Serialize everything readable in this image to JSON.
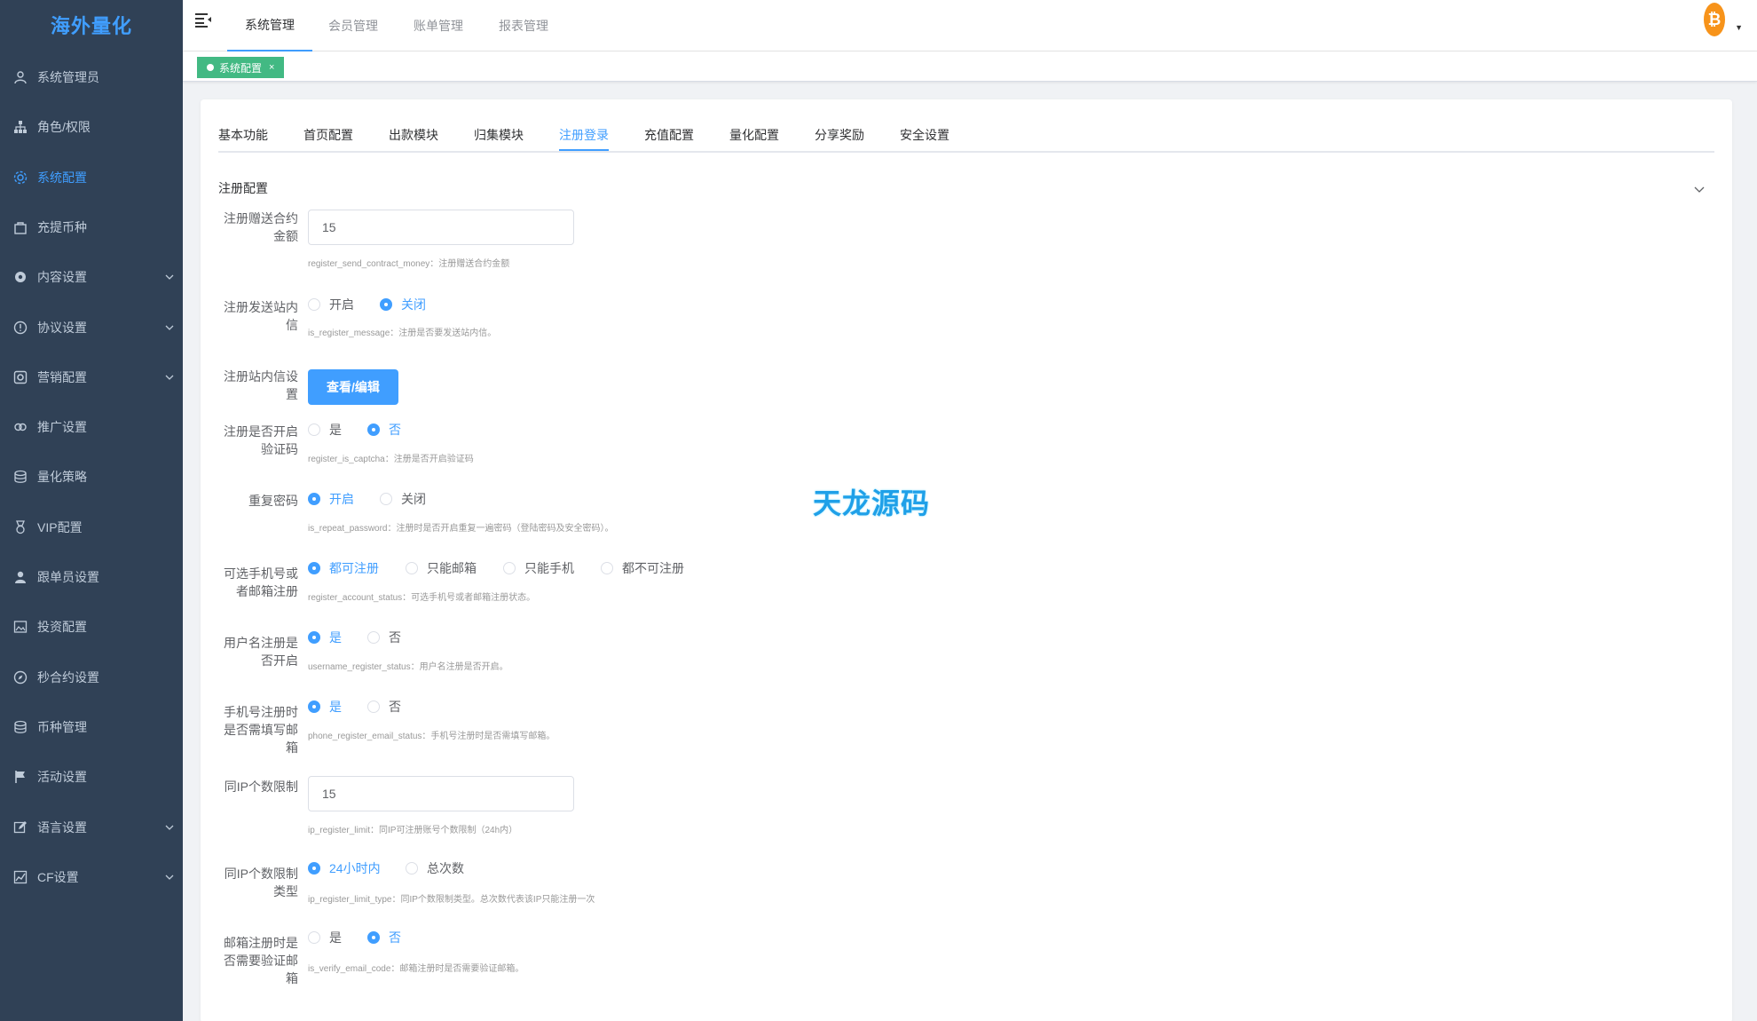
{
  "app": {
    "logo_text": "海外量化"
  },
  "sidebar": {
    "items": [
      {
        "label": "系统管理员",
        "icon": "user-icon",
        "active": false,
        "has_arrow": false
      },
      {
        "label": "角色/权限",
        "icon": "tree-icon",
        "active": false,
        "has_arrow": false
      },
      {
        "label": "系统配置",
        "icon": "gear-icon",
        "active": true,
        "has_arrow": false
      },
      {
        "label": "充提币种",
        "icon": "bag-icon",
        "active": false,
        "has_arrow": false
      },
      {
        "label": "内容设置",
        "icon": "gear-solid-icon",
        "active": false,
        "has_arrow": true
      },
      {
        "label": "协议设置",
        "icon": "info-circle-icon",
        "active": false,
        "has_arrow": true
      },
      {
        "label": "营销配置",
        "icon": "ecommerce-icon",
        "active": false,
        "has_arrow": true
      },
      {
        "label": "推广设置",
        "icon": "link-icon",
        "active": false,
        "has_arrow": false
      },
      {
        "label": "量化策略",
        "icon": "database-icon",
        "active": false,
        "has_arrow": false
      },
      {
        "label": "VIP配置",
        "icon": "medal-icon",
        "active": false,
        "has_arrow": false
      },
      {
        "label": "跟单员设置",
        "icon": "person-solid-icon",
        "active": false,
        "has_arrow": false
      },
      {
        "label": "投资配置",
        "icon": "image-icon",
        "active": false,
        "has_arrow": false
      },
      {
        "label": "秒合约设置",
        "icon": "compass-icon",
        "active": false,
        "has_arrow": false
      },
      {
        "label": "币种管理",
        "icon": "coins-icon",
        "active": false,
        "has_arrow": false
      },
      {
        "label": "活动设置",
        "icon": "flag-icon",
        "active": false,
        "has_arrow": false
      },
      {
        "label": "语言设置",
        "icon": "edit-icon",
        "active": false,
        "has_arrow": true
      },
      {
        "label": "CF设置",
        "icon": "chart-icon",
        "active": false,
        "has_arrow": true
      }
    ]
  },
  "topnav": {
    "tabs": [
      {
        "label": "系统管理",
        "active": true
      },
      {
        "label": "会员管理",
        "active": false
      },
      {
        "label": "账单管理",
        "active": false
      },
      {
        "label": "报表管理",
        "active": false
      }
    ],
    "avatar_glyph": "₿"
  },
  "tagsview": {
    "tag_label": "系统配置",
    "close_glyph": "×"
  },
  "config_tabs": [
    {
      "label": "基本功能",
      "active": false
    },
    {
      "label": "首页配置",
      "active": false
    },
    {
      "label": "出款模块",
      "active": false
    },
    {
      "label": "归集模块",
      "active": false
    },
    {
      "label": "注册登录",
      "active": true
    },
    {
      "label": "充值配置",
      "active": false
    },
    {
      "label": "量化配置",
      "active": false
    },
    {
      "label": "分享奖励",
      "active": false
    },
    {
      "label": "安全设置",
      "active": false
    }
  ],
  "section": {
    "title": "注册配置"
  },
  "form": {
    "f1": {
      "label": "注册赠送合约金额",
      "value": "15",
      "hint": "register_send_contract_money：注册赠送合约金额"
    },
    "f2": {
      "label": "注册发送站内信",
      "opt1": "开启",
      "opt2": "关闭",
      "selected": 2,
      "hint": "is_register_message：注册是否要发送站内信。"
    },
    "f3": {
      "label": "注册站内信设置",
      "button": "查看/编辑"
    },
    "f4": {
      "label": "注册是否开启验证码",
      "opt1": "是",
      "opt2": "否",
      "selected": 2,
      "hint": "register_is_captcha：注册是否开启验证码"
    },
    "f5": {
      "label": "重复密码",
      "opt1": "开启",
      "opt2": "关闭",
      "selected": 1,
      "hint": "is_repeat_password：注册时是否开启重复一遍密码（登陆密码及安全密码）。"
    },
    "f6": {
      "label": "可选手机号或者邮箱注册",
      "opt1": "都可注册",
      "opt2": "只能邮箱",
      "opt3": "只能手机",
      "opt4": "都不可注册",
      "selected": 1,
      "hint": "register_account_status：可选手机号或者邮箱注册状态。"
    },
    "f7": {
      "label": "用户名注册是否开启",
      "opt1": "是",
      "opt2": "否",
      "selected": 1,
      "hint": "username_register_status：用户名注册是否开启。"
    },
    "f8": {
      "label": "手机号注册时是否需填写邮箱",
      "opt1": "是",
      "opt2": "否",
      "selected": 1,
      "hint": "phone_register_email_status：手机号注册时是否需填写邮箱。"
    },
    "f9": {
      "label": "同IP个数限制",
      "value": "15",
      "hint": "ip_register_limit：同IP可注册账号个数限制（24h内）"
    },
    "f10": {
      "label": "同IP个数限制类型",
      "opt1": "24小时内",
      "opt2": "总次数",
      "selected": 1,
      "hint": "ip_register_limit_type：同IP个数限制类型。总次数代表该IP只能注册一次"
    },
    "f11": {
      "label": "邮箱注册时是否需要验证邮箱",
      "opt1": "是",
      "opt2": "否",
      "selected": 2,
      "hint": "is_verify_email_code：邮箱注册时是否需要验证邮箱。"
    }
  },
  "watermark": "天龙源码",
  "colors": {
    "sidebar_bg": "#304156",
    "primary": "#409eff",
    "tag_green": "#42b983"
  }
}
